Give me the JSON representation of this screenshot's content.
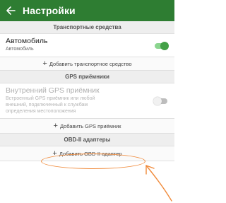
{
  "appbar": {
    "back_icon": "arrow-left-icon",
    "title": "Настройки",
    "color": "#2e7d32"
  },
  "sections": {
    "vehicles": {
      "header": "Транспортные средства",
      "item": {
        "label": "Автомобиль",
        "sublabel": "Автомобиль",
        "enabled": true
      },
      "add_label": "Добавить транспортное средство"
    },
    "gps": {
      "header": "GPS приёмники",
      "item": {
        "label": "Внутренний GPS приёмник",
        "sublabel": "Встроенный GPS приёмник или любой внешний, подключенный к службам определения местоположения",
        "enabled": false
      },
      "add_label": "Добавить GPS приёмник"
    },
    "obd": {
      "header": "OBD-II адаптеры",
      "add_label": "Добавить OBD-II адаптер"
    }
  },
  "annotation_color": "#f08a3a",
  "plus_glyph": "+"
}
